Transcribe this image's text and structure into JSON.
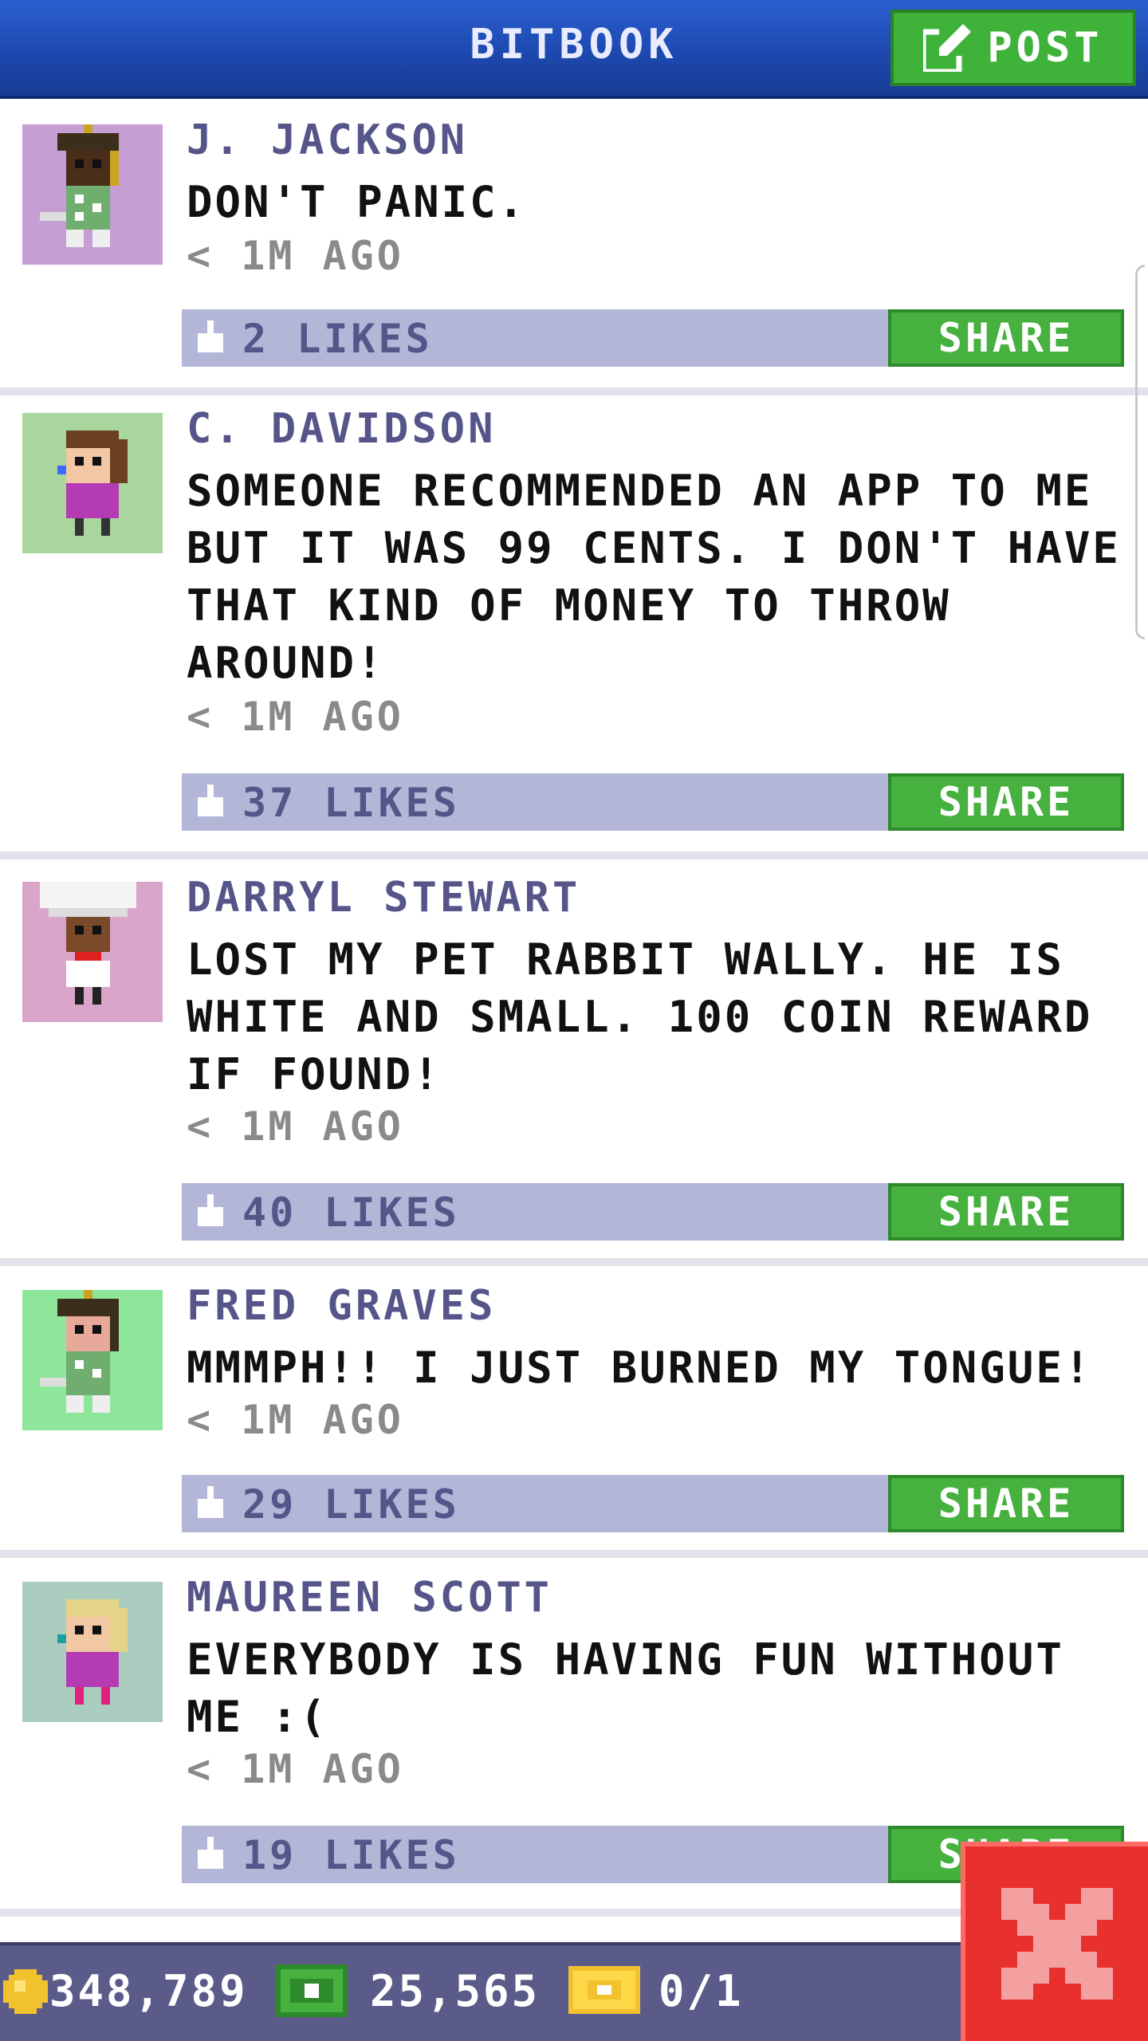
{
  "header": {
    "title": "BITBOOK",
    "post_label": "POST"
  },
  "posts": [
    {
      "name": "J. JACKSON",
      "message": "DON'T PANIC.",
      "time": "< 1M AGO",
      "likes": "2 LIKES",
      "share_label": "SHARE",
      "avatar_bg": "#c59ed4"
    },
    {
      "name": "C. DAVIDSON",
      "message": "SOMEONE RECOMMENDED AN APP TO ME BUT IT WAS 99 CENTS. I DON'T HAVE THAT KIND OF MONEY TO THROW AROUND!",
      "time": "< 1M AGO",
      "likes": "37 LIKES",
      "share_label": "SHARE",
      "avatar_bg": "#a9d69c"
    },
    {
      "name": "DARRYL STEWART",
      "message": "LOST MY PET RABBIT WALLY. HE IS WHITE AND SMALL. 100 COIN REWARD IF FOUND!",
      "time": "< 1M AGO",
      "likes": "40 LIKES",
      "share_label": "SHARE",
      "avatar_bg": "#d9a6c9"
    },
    {
      "name": "FRED GRAVES",
      "message": "MMMPH!! I JUST BURNED MY TONGUE!",
      "time": "< 1M AGO",
      "likes": "29 LIKES",
      "share_label": "SHARE",
      "avatar_bg": "#8ee69a"
    },
    {
      "name": "MAUREEN SCOTT",
      "message": "EVERYBODY IS HAVING FUN WITHOUT ME :(",
      "time": "< 1M AGO",
      "likes": "19 LIKES",
      "share_label": "SHARE",
      "avatar_bg": "#aacdbf"
    }
  ],
  "footer": {
    "coins": "348,789",
    "bux": "25,565",
    "tickets": "0/1"
  },
  "icons": {
    "post": "edit-icon",
    "like": "thumb-icon",
    "coin": "coin-icon",
    "bux": "bux-icon",
    "ticket": "ticket-icon",
    "close": "close-icon"
  },
  "colors": {
    "header_bg": "#1d49b0",
    "accent_green": "#46b13e",
    "likes_bar": "#b3b6d6",
    "name_text": "#55558a",
    "footer_bg": "#5b5b8a",
    "close_red": "#e8302e"
  }
}
